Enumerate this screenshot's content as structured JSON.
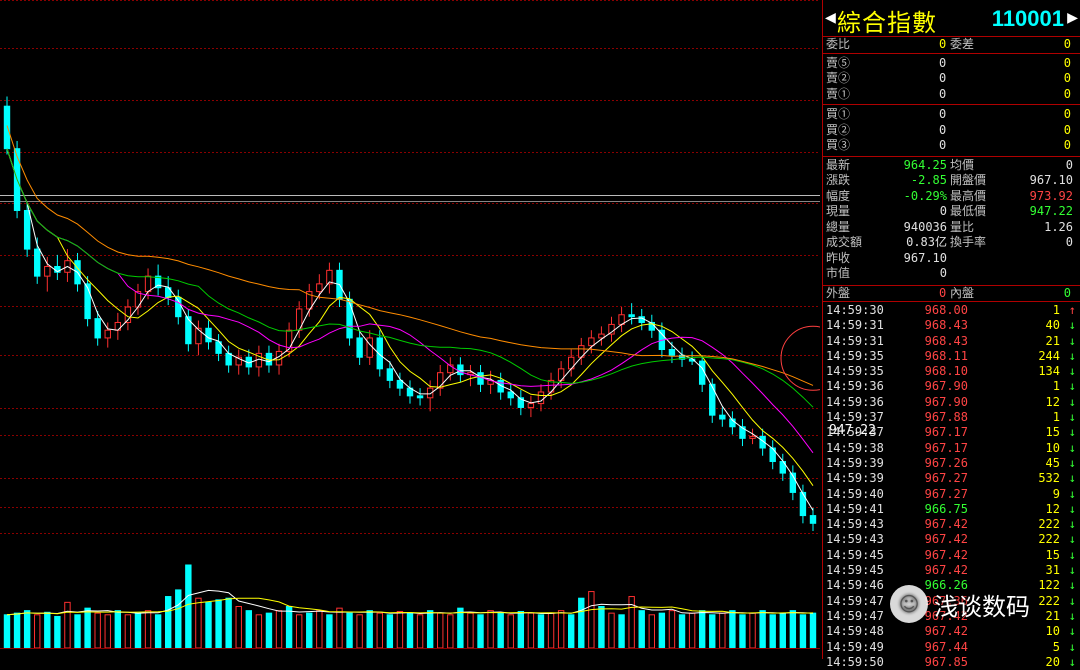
{
  "header": {
    "arrow_left": "◀",
    "title": "綜合指數",
    "code": "110001",
    "arrow_right": "▶"
  },
  "ratio": {
    "weibi_label": "委比",
    "weibi_value": "0",
    "weicha_label": "委差",
    "weicha_value": "0"
  },
  "sells": [
    {
      "label": "賣⑤",
      "price": "0",
      "vol": "0"
    },
    {
      "label": "賣②",
      "price": "0",
      "vol": "0"
    },
    {
      "label": "賣①",
      "price": "0",
      "vol": "0"
    }
  ],
  "buys": [
    {
      "label": "買①",
      "price": "0",
      "vol": "0"
    },
    {
      "label": "買②",
      "price": "0",
      "vol": "0"
    },
    {
      "label": "買③",
      "price": "0",
      "vol": "0"
    }
  ],
  "quote": [
    {
      "l1": "最新",
      "v1": "964.25",
      "c1": "grn",
      "l2": "均價",
      "v2": "0",
      "c2": "wht"
    },
    {
      "l1": "漲跌",
      "v1": "-2.85",
      "c1": "grn",
      "l2": "開盤價",
      "v2": "967.10",
      "c2": "wht"
    },
    {
      "l1": "幅度",
      "v1": "-0.29%",
      "c1": "grn",
      "l2": "最高價",
      "v2": "973.92",
      "c2": "red"
    },
    {
      "l1": "現量",
      "v1": "0",
      "c1": "wht",
      "l2": "最低價",
      "v2": "947.22",
      "c2": "grn"
    },
    {
      "l1": "總量",
      "v1": "940036",
      "c1": "wht",
      "l2": "量比",
      "v2": "1.26",
      "c2": "wht"
    },
    {
      "l1": "成交額",
      "v1": "0.83亿",
      "c1": "wht",
      "l2": "換手率",
      "v2": "0",
      "c2": "wht"
    },
    {
      "l1": "昨收",
      "v1": "967.10",
      "c1": "wht",
      "l2": "",
      "v2": "",
      "c2": "wht"
    },
    {
      "l1": "市值",
      "v1": "0",
      "c1": "wht",
      "l2": "",
      "v2": "",
      "c2": "wht"
    }
  ],
  "outer_inner": {
    "wai_label": "外盤",
    "wai_value": "0",
    "nei_label": "內盤",
    "nei_value": "0"
  },
  "ticks": [
    {
      "time": "14:59:30",
      "price": "968.00",
      "pc": "red",
      "vol": "1",
      "dir": "↑",
      "dc": "red"
    },
    {
      "time": "14:59:31",
      "price": "968.43",
      "pc": "red",
      "vol": "40",
      "dir": "↓",
      "dc": "grn"
    },
    {
      "time": "14:59:31",
      "price": "968.43",
      "pc": "red",
      "vol": "21",
      "dir": "↓",
      "dc": "grn"
    },
    {
      "time": "14:59:35",
      "price": "968.11",
      "pc": "red",
      "vol": "244",
      "dir": "↓",
      "dc": "grn"
    },
    {
      "time": "14:59:35",
      "price": "968.10",
      "pc": "red",
      "vol": "134",
      "dir": "↓",
      "dc": "grn"
    },
    {
      "time": "14:59:36",
      "price": "967.90",
      "pc": "red",
      "vol": "1",
      "dir": "↓",
      "dc": "grn"
    },
    {
      "time": "14:59:36",
      "price": "967.90",
      "pc": "red",
      "vol": "12",
      "dir": "↓",
      "dc": "grn"
    },
    {
      "time": "14:59:37",
      "price": "967.88",
      "pc": "red",
      "vol": "1",
      "dir": "↓",
      "dc": "grn"
    },
    {
      "time": "14:59:37",
      "price": "967.17",
      "pc": "red",
      "vol": "15",
      "dir": "↓",
      "dc": "grn"
    },
    {
      "time": "14:59:38",
      "price": "967.17",
      "pc": "red",
      "vol": "10",
      "dir": "↓",
      "dc": "grn"
    },
    {
      "time": "14:59:39",
      "price": "967.26",
      "pc": "red",
      "vol": "45",
      "dir": "↓",
      "dc": "grn"
    },
    {
      "time": "14:59:39",
      "price": "967.27",
      "pc": "red",
      "vol": "532",
      "dir": "↓",
      "dc": "grn"
    },
    {
      "time": "14:59:40",
      "price": "967.27",
      "pc": "red",
      "vol": "9",
      "dir": "↓",
      "dc": "grn"
    },
    {
      "time": "14:59:41",
      "price": "966.75",
      "pc": "grn",
      "vol": "12",
      "dir": "↓",
      "dc": "grn"
    },
    {
      "time": "14:59:43",
      "price": "967.42",
      "pc": "red",
      "vol": "222",
      "dir": "↓",
      "dc": "grn"
    },
    {
      "time": "14:59:43",
      "price": "967.42",
      "pc": "red",
      "vol": "222",
      "dir": "↓",
      "dc": "grn"
    },
    {
      "time": "14:59:45",
      "price": "967.42",
      "pc": "red",
      "vol": "15",
      "dir": "↓",
      "dc": "grn"
    },
    {
      "time": "14:59:45",
      "price": "967.42",
      "pc": "red",
      "vol": "31",
      "dir": "↓",
      "dc": "grn"
    },
    {
      "time": "14:59:46",
      "price": "966.26",
      "pc": "grn",
      "vol": "122",
      "dir": "↓",
      "dc": "grn"
    },
    {
      "time": "14:59:47",
      "price": "967.36",
      "pc": "red",
      "vol": "222",
      "dir": "↓",
      "dc": "grn"
    },
    {
      "time": "14:59:47",
      "price": "967.42",
      "pc": "red",
      "vol": "21",
      "dir": "↓",
      "dc": "grn"
    },
    {
      "time": "14:59:48",
      "price": "967.42",
      "pc": "red",
      "vol": "10",
      "dir": "↓",
      "dc": "grn"
    },
    {
      "time": "14:59:49",
      "price": "967.44",
      "pc": "red",
      "vol": "5",
      "dir": "↓",
      "dc": "grn"
    },
    {
      "time": "14:59:50",
      "price": "967.85",
      "pc": "red",
      "vol": "20",
      "dir": "↓",
      "dc": "grn"
    }
  ],
  "last_price_label": "947.22",
  "watermark": {
    "icon": "chat-bubble-icon",
    "text": "浅谈数码"
  },
  "colors": {
    "up": "#ff3030",
    "down": "#00ffff",
    "ma1": "#ffffff",
    "ma2": "#ffff00",
    "ma3": "#ff00ff",
    "ma4": "#00cc00",
    "ma5": "#ff8c00",
    "grid": "#8b0000"
  },
  "chart_data": {
    "type": "candlestick",
    "candles": [
      [
        961.0,
        961.5,
        958.5,
        958.8
      ],
      [
        958.8,
        959.2,
        955.2,
        955.6
      ],
      [
        955.6,
        956.0,
        953.2,
        953.6
      ],
      [
        953.6,
        954.2,
        951.8,
        952.2
      ],
      [
        952.2,
        953.2,
        951.4,
        952.7
      ],
      [
        952.7,
        953.3,
        952.0,
        952.4
      ],
      [
        952.4,
        953.6,
        951.9,
        953.0
      ],
      [
        953.0,
        953.4,
        951.4,
        951.8
      ],
      [
        951.8,
        952.2,
        949.6,
        950.0
      ],
      [
        950.0,
        950.4,
        948.6,
        949.0
      ],
      [
        949.0,
        949.8,
        948.5,
        949.4
      ],
      [
        949.4,
        950.3,
        948.9,
        949.8
      ],
      [
        949.8,
        951.0,
        949.4,
        950.6
      ],
      [
        950.6,
        951.8,
        950.2,
        951.4
      ],
      [
        951.4,
        952.6,
        951.0,
        952.2
      ],
      [
        952.2,
        952.8,
        951.2,
        951.6
      ],
      [
        951.6,
        952.2,
        950.7,
        951.1
      ],
      [
        951.1,
        951.5,
        949.7,
        950.1
      ],
      [
        950.1,
        950.5,
        948.3,
        948.7
      ],
      [
        948.7,
        949.9,
        948.1,
        949.5
      ],
      [
        949.5,
        949.9,
        948.4,
        948.8
      ],
      [
        948.8,
        949.2,
        947.8,
        948.2
      ],
      [
        948.2,
        948.6,
        947.2,
        947.6
      ],
      [
        947.6,
        948.4,
        947.1,
        948.0
      ],
      [
        948.0,
        948.4,
        947.1,
        947.5
      ],
      [
        947.5,
        948.6,
        947.0,
        948.2
      ],
      [
        948.2,
        948.6,
        947.2,
        947.6
      ],
      [
        947.6,
        948.7,
        947.1,
        948.3
      ],
      [
        948.3,
        949.8,
        948.0,
        949.4
      ],
      [
        949.4,
        950.9,
        949.0,
        950.5
      ],
      [
        950.5,
        951.8,
        950.1,
        951.4
      ],
      [
        951.4,
        952.3,
        951.0,
        951.8
      ],
      [
        951.8,
        952.9,
        951.3,
        952.5
      ],
      [
        952.5,
        952.9,
        950.6,
        951.0
      ],
      [
        951.0,
        951.4,
        948.6,
        949.0
      ],
      [
        949.0,
        949.4,
        947.6,
        948.0
      ],
      [
        948.0,
        949.4,
        947.6,
        949.0
      ],
      [
        949.0,
        949.4,
        947.0,
        947.4
      ],
      [
        947.4,
        947.8,
        946.4,
        946.8
      ],
      [
        946.8,
        947.2,
        946.0,
        946.4
      ],
      [
        946.4,
        946.8,
        945.6,
        946.0
      ],
      [
        946.0,
        946.4,
        945.5,
        945.9
      ],
      [
        945.9,
        946.8,
        945.2,
        946.4
      ],
      [
        946.4,
        947.6,
        946.0,
        947.2
      ],
      [
        947.2,
        948.0,
        946.8,
        947.6
      ],
      [
        947.6,
        948.0,
        946.7,
        947.1
      ],
      [
        947.1,
        947.6,
        946.5,
        947.2
      ],
      [
        947.2,
        947.6,
        946.2,
        946.6
      ],
      [
        946.6,
        947.3,
        946.1,
        946.8
      ],
      [
        946.8,
        947.2,
        945.8,
        946.2
      ],
      [
        946.2,
        946.6,
        945.5,
        945.9
      ],
      [
        945.9,
        946.3,
        945.0,
        945.4
      ],
      [
        945.4,
        946.0,
        944.9,
        945.6
      ],
      [
        945.6,
        946.6,
        945.2,
        946.2
      ],
      [
        946.2,
        947.2,
        945.8,
        946.8
      ],
      [
        946.8,
        947.8,
        946.4,
        947.4
      ],
      [
        947.4,
        948.4,
        947.0,
        948.0
      ],
      [
        948.0,
        949.0,
        947.6,
        948.6
      ],
      [
        948.6,
        949.4,
        948.2,
        949.0
      ],
      [
        949.0,
        949.6,
        948.6,
        949.2
      ],
      [
        949.2,
        950.1,
        948.8,
        949.7
      ],
      [
        949.7,
        950.6,
        949.3,
        950.2
      ],
      [
        950.2,
        950.8,
        949.7,
        950.1
      ],
      [
        950.1,
        950.5,
        949.4,
        949.8
      ],
      [
        949.8,
        950.2,
        949.0,
        949.4
      ],
      [
        949.4,
        949.8,
        948.0,
        948.4
      ],
      [
        948.4,
        948.8,
        947.7,
        948.1
      ],
      [
        948.1,
        948.5,
        947.5,
        947.9
      ],
      [
        947.9,
        948.3,
        947.6,
        947.8
      ],
      [
        947.8,
        948.1,
        946.2,
        946.6
      ],
      [
        946.6,
        946.9,
        944.6,
        945.0
      ],
      [
        945.0,
        945.4,
        944.4,
        944.8
      ],
      [
        944.8,
        945.2,
        944.0,
        944.4
      ],
      [
        944.4,
        944.8,
        943.4,
        943.8
      ],
      [
        943.8,
        944.3,
        943.5,
        943.9
      ],
      [
        943.9,
        944.3,
        942.9,
        943.3
      ],
      [
        943.3,
        943.7,
        942.2,
        942.6
      ],
      [
        942.6,
        943.0,
        941.6,
        942.0
      ],
      [
        942.0,
        942.4,
        940.6,
        941.0
      ],
      [
        941.0,
        941.4,
        939.4,
        939.8
      ],
      [
        939.8,
        940.2,
        939.0,
        939.4
      ]
    ],
    "volume": [
      [
        0.4,
        "down"
      ],
      [
        0.42,
        "down"
      ],
      [
        0.45,
        "down"
      ],
      [
        0.4,
        "up"
      ],
      [
        0.43,
        "down"
      ],
      [
        0.38,
        "down"
      ],
      [
        0.55,
        "up"
      ],
      [
        0.4,
        "down"
      ],
      [
        0.48,
        "down"
      ],
      [
        0.42,
        "up"
      ],
      [
        0.4,
        "up"
      ],
      [
        0.45,
        "down"
      ],
      [
        0.4,
        "up"
      ],
      [
        0.42,
        "down"
      ],
      [
        0.45,
        "up"
      ],
      [
        0.4,
        "down"
      ],
      [
        0.62,
        "down"
      ],
      [
        0.7,
        "down"
      ],
      [
        1.0,
        "down"
      ],
      [
        0.6,
        "up"
      ],
      [
        0.55,
        "down"
      ],
      [
        0.58,
        "down"
      ],
      [
        0.6,
        "down"
      ],
      [
        0.5,
        "up"
      ],
      [
        0.45,
        "down"
      ],
      [
        0.4,
        "up"
      ],
      [
        0.42,
        "down"
      ],
      [
        0.45,
        "up"
      ],
      [
        0.5,
        "down"
      ],
      [
        0.4,
        "up"
      ],
      [
        0.42,
        "down"
      ],
      [
        0.45,
        "up"
      ],
      [
        0.4,
        "down"
      ],
      [
        0.48,
        "up"
      ],
      [
        0.42,
        "down"
      ],
      [
        0.4,
        "up"
      ],
      [
        0.45,
        "down"
      ],
      [
        0.42,
        "up"
      ],
      [
        0.4,
        "down"
      ],
      [
        0.44,
        "up"
      ],
      [
        0.42,
        "down"
      ],
      [
        0.4,
        "up"
      ],
      [
        0.45,
        "down"
      ],
      [
        0.42,
        "up"
      ],
      [
        0.4,
        "up"
      ],
      [
        0.48,
        "down"
      ],
      [
        0.42,
        "up"
      ],
      [
        0.4,
        "down"
      ],
      [
        0.45,
        "up"
      ],
      [
        0.42,
        "down"
      ],
      [
        0.4,
        "up"
      ],
      [
        0.44,
        "down"
      ],
      [
        0.42,
        "up"
      ],
      [
        0.4,
        "down"
      ],
      [
        0.42,
        "up"
      ],
      [
        0.45,
        "up"
      ],
      [
        0.4,
        "down"
      ],
      [
        0.6,
        "down"
      ],
      [
        0.68,
        "up"
      ],
      [
        0.5,
        "down"
      ],
      [
        0.42,
        "up"
      ],
      [
        0.4,
        "down"
      ],
      [
        0.62,
        "up"
      ],
      [
        0.45,
        "down"
      ],
      [
        0.4,
        "up"
      ],
      [
        0.42,
        "down"
      ],
      [
        0.45,
        "up"
      ],
      [
        0.4,
        "down"
      ],
      [
        0.42,
        "up"
      ],
      [
        0.45,
        "down"
      ],
      [
        0.4,
        "down"
      ],
      [
        0.42,
        "up"
      ],
      [
        0.45,
        "down"
      ],
      [
        0.4,
        "down"
      ],
      [
        0.42,
        "up"
      ],
      [
        0.45,
        "down"
      ],
      [
        0.4,
        "down"
      ],
      [
        0.42,
        "down"
      ],
      [
        0.45,
        "down"
      ],
      [
        0.4,
        "down"
      ],
      [
        0.42,
        "down"
      ]
    ],
    "ylim": [
      937.5,
      966.5
    ],
    "last_price": 947.22
  }
}
